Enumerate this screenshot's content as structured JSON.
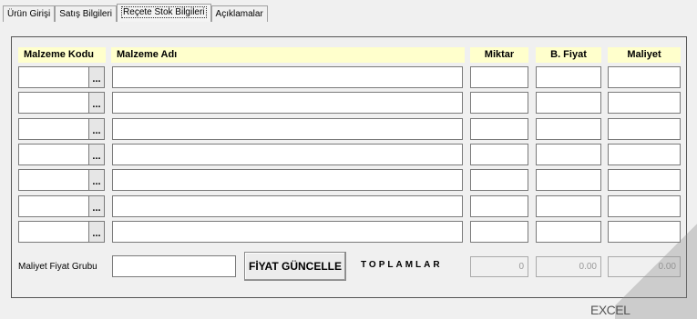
{
  "tabs": [
    {
      "label": "Ürün Girişi"
    },
    {
      "label": "Satış Bilgileri"
    },
    {
      "label": "Reçete Stok Bilgileri"
    },
    {
      "label": "Açıklamalar"
    }
  ],
  "table": {
    "headers": {
      "code": "Malzeme Kodu",
      "name": "Malzeme Adı",
      "qty": "Miktar",
      "price": "B. Fiyat",
      "cost": "Maliyet"
    },
    "browse_label": "...",
    "row_count": 7
  },
  "footer": {
    "group_label": "Maliyet Fiyat Grubu",
    "group_value": "",
    "update_button": "FİYAT GÜNCELLE",
    "totals_label": "TOPLAMLAR",
    "total_qty": "0",
    "total_price": "0.00",
    "total_cost": "0.00"
  },
  "watermark": "EXCEL"
}
